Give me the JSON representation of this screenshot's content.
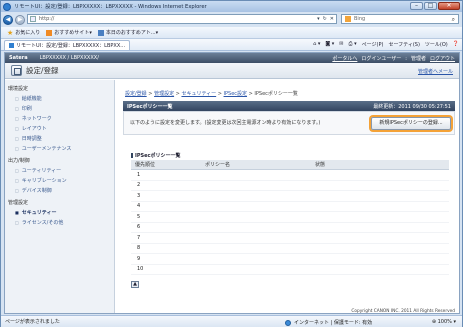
{
  "browser": {
    "title": "リモートUI：設定/登録：LBPXXXXX：LBPXXXXX - Windows Internet Explorer",
    "address": "http://",
    "search_provider": "Bing",
    "favorites": {
      "label": "お気に入り",
      "item1": "おすすめサイト",
      "item2": "本日のおすすめアト..."
    },
    "tab_label": "リモートUI：設定/登録：LBPXXXXX：LBPXX...",
    "commands": {
      "page": "ページ(P)",
      "safety": "セーフティ(S)",
      "tools": "ツール(O)"
    },
    "status_left": "ページが表示されました",
    "status_zone": "インターネット | 保護モード: 有効",
    "zoom": "100%"
  },
  "rui": {
    "brand": "Satera",
    "model": "LBPXXXXX / LBPXXXXX/",
    "portal_link": "ポータルへ",
    "login_user": "ログインユーザー",
    "admin": "管理者",
    "logout": "ログアウト",
    "page_title": "設定/登録",
    "mail_link": "管理者へメール"
  },
  "menu": {
    "group1": "環境設定",
    "items1": [
      "給紙機能",
      "印刷",
      "ネットワーク",
      "レイアウト",
      "日時調整",
      "ユーザーメンテナンス"
    ],
    "group2": "出力/制御",
    "items2": [
      "ユーティリティー",
      "キャリブレーション",
      "デバイス制御"
    ],
    "group3": "管理設定",
    "items3": [
      "セキュリティー",
      "ライセンス/その他"
    ]
  },
  "main": {
    "breadcrumb": {
      "part1": "設定/登録",
      "part2": "管理設定",
      "part3": "セキュリティー",
      "part4": "IPSec設定",
      "current": "IPSecポリシー一覧"
    },
    "panel_title": "IPSecポリシー一覧",
    "last_updated": "最終更新：2011 09/30 05:27:51",
    "notice": "以下のように設定を変更します。(設定変更は次回主電源オン時より有効になります。)",
    "register_button": "新規IPSecポリシーの登録...",
    "list_title": "IPSecポリシー一覧",
    "columns": [
      "優先順位",
      "ポリシー名",
      "状態"
    ],
    "rows": [
      "1",
      "2",
      "3",
      "4",
      "5",
      "6",
      "7",
      "8",
      "9",
      "10"
    ],
    "copyright": "Copyright CANON INC. 2011 All Rights Reserved"
  }
}
